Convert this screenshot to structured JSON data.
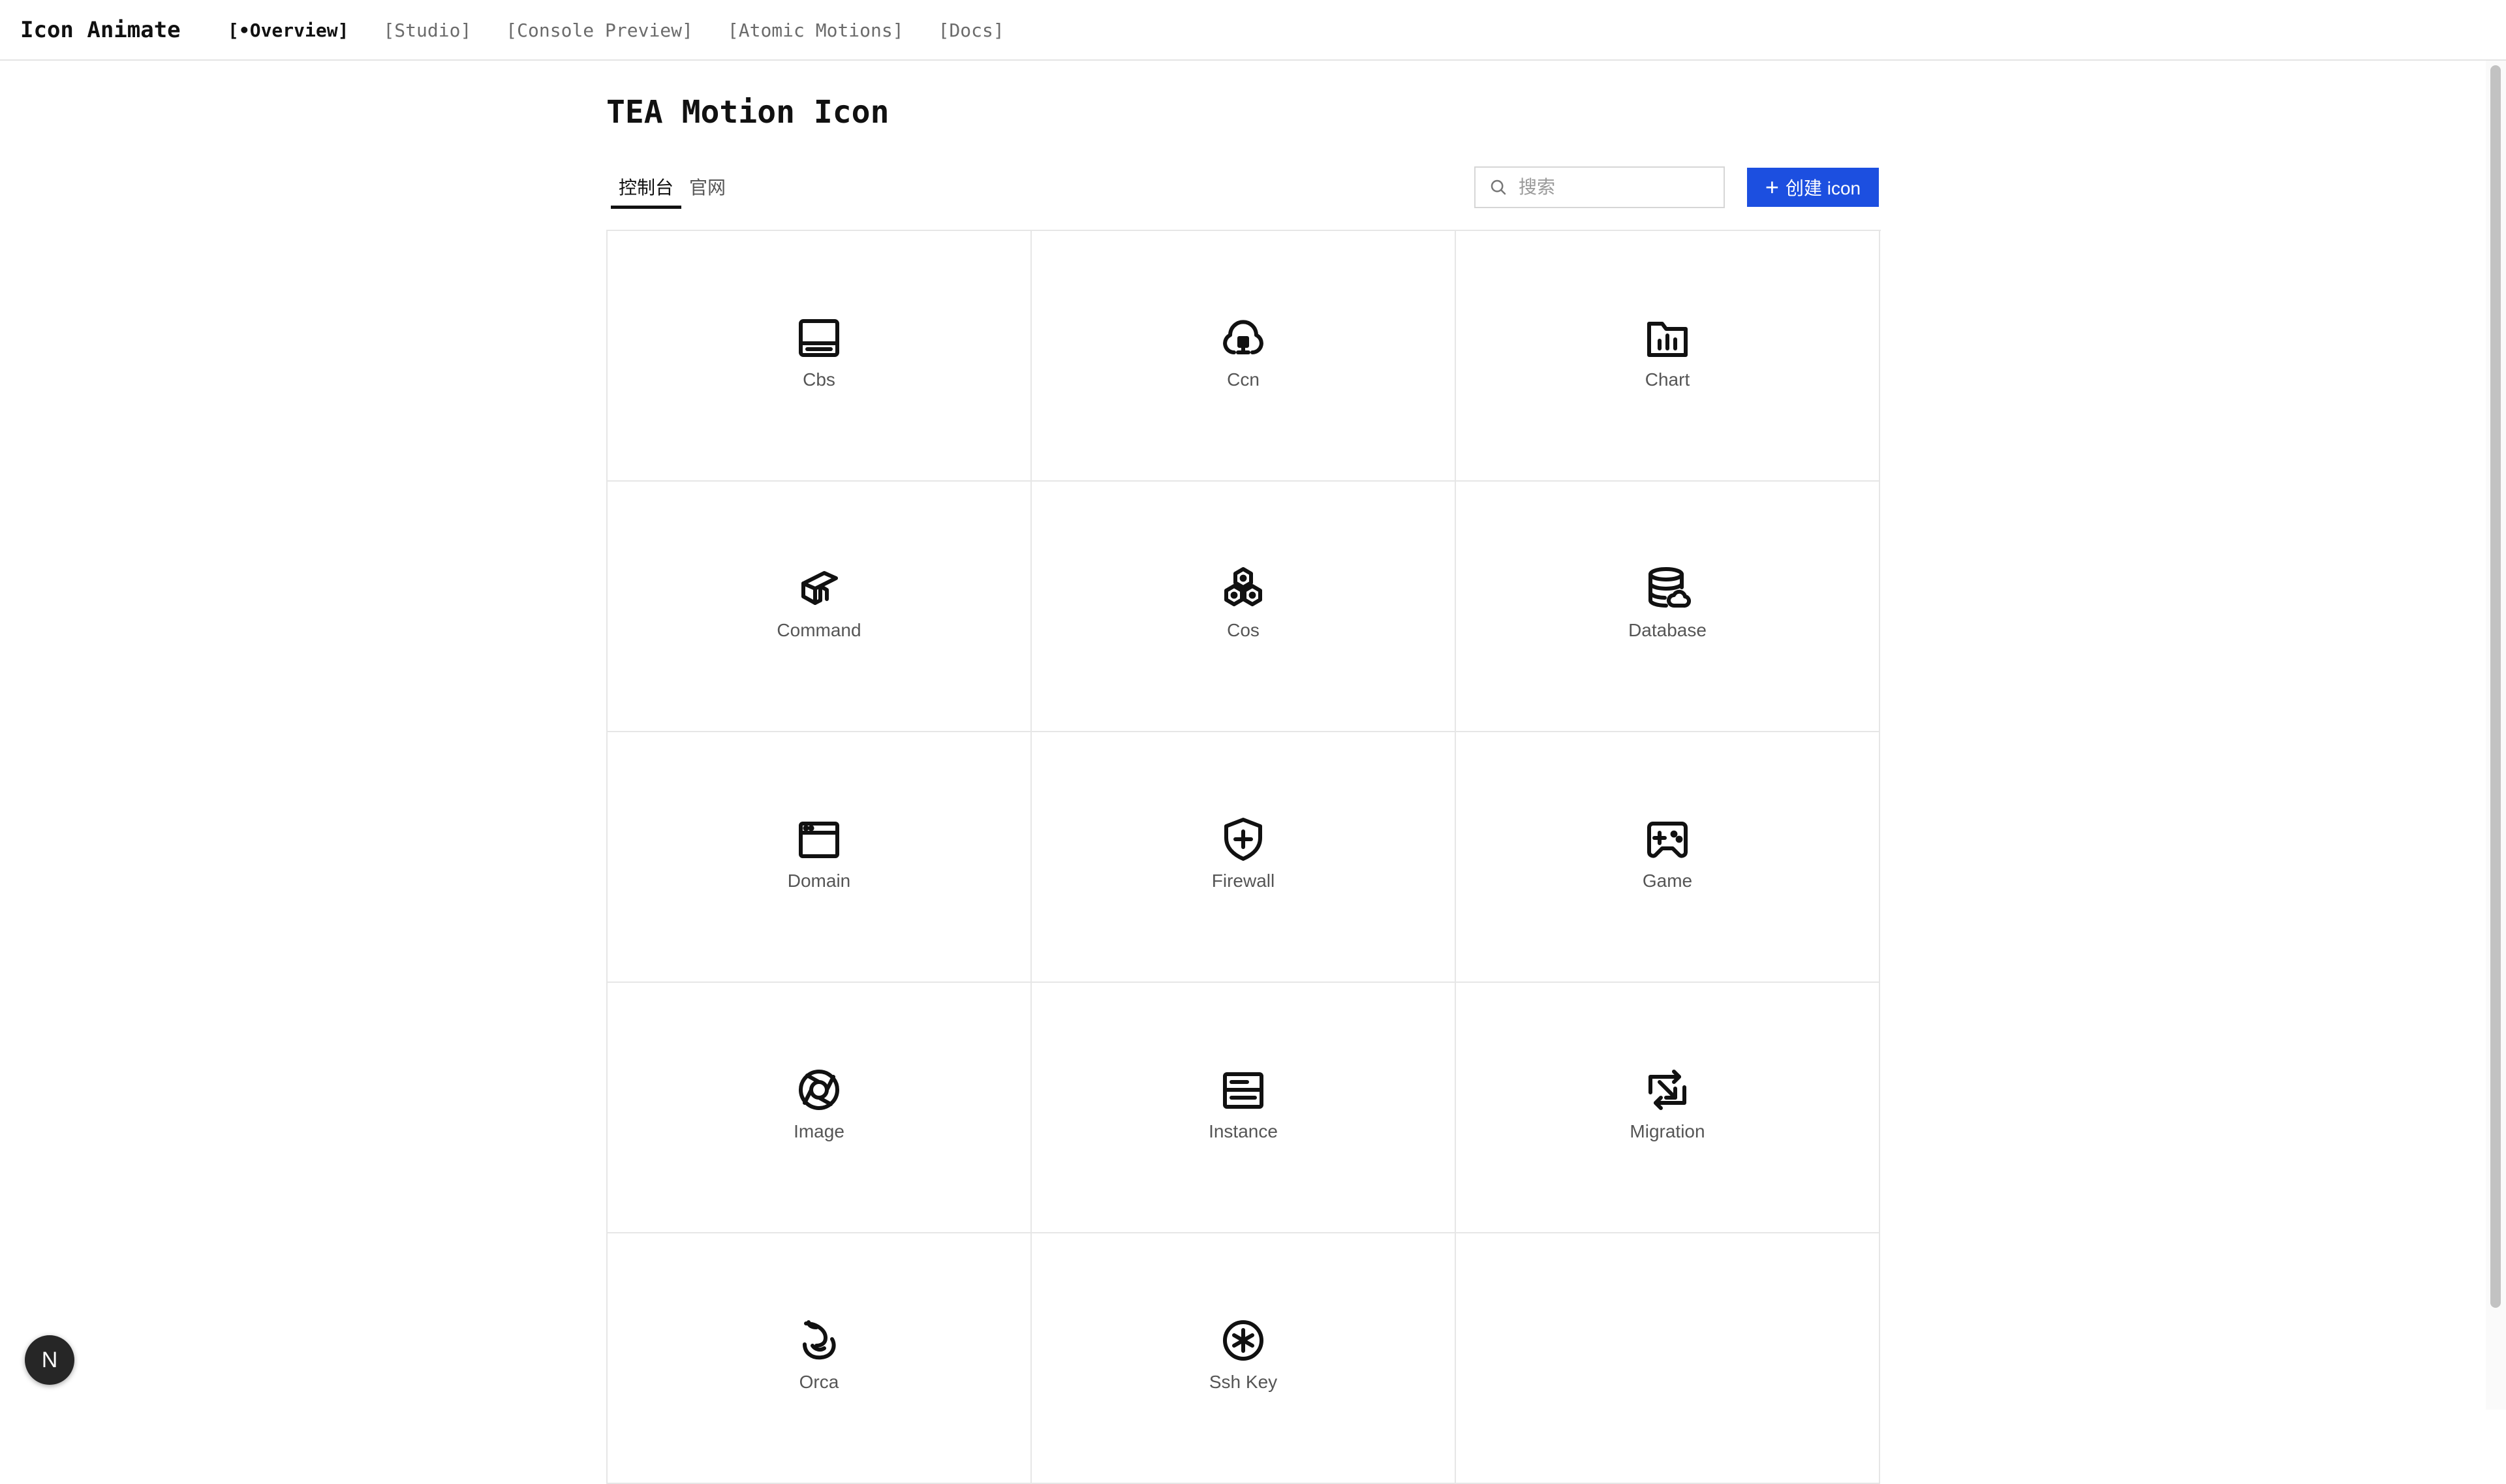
{
  "app": {
    "brand": "Icon Animate",
    "nav": [
      {
        "label": "[•Overview]",
        "active": true
      },
      {
        "label": "[Studio]",
        "active": false
      },
      {
        "label": "[Console Preview]",
        "active": false
      },
      {
        "label": "[Atomic Motions]",
        "active": false
      },
      {
        "label": "[Docs]",
        "active": false
      }
    ]
  },
  "main": {
    "title": "TEA Motion Icon",
    "tabs": [
      {
        "label": "控制台",
        "active": true
      },
      {
        "label": "官网",
        "active": false
      }
    ],
    "search": {
      "placeholder": "搜索",
      "value": ""
    },
    "create_button": {
      "label": "创建 icon",
      "icon": "plus-icon"
    },
    "icons": [
      {
        "label": "Cbs",
        "icon": "cbs-icon"
      },
      {
        "label": "Ccn",
        "icon": "ccn-icon"
      },
      {
        "label": "Chart",
        "icon": "chart-icon"
      },
      {
        "label": "Command",
        "icon": "command-icon"
      },
      {
        "label": "Cos",
        "icon": "cos-icon"
      },
      {
        "label": "Database",
        "icon": "database-icon"
      },
      {
        "label": "Domain",
        "icon": "domain-icon"
      },
      {
        "label": "Firewall",
        "icon": "firewall-icon"
      },
      {
        "label": "Game",
        "icon": "game-icon"
      },
      {
        "label": "Image",
        "icon": "image-icon"
      },
      {
        "label": "Instance",
        "icon": "instance-icon"
      },
      {
        "label": "Migration",
        "icon": "migration-icon"
      },
      {
        "label": "Orca",
        "icon": "orca-icon"
      },
      {
        "label": "Ssh Key",
        "icon": "ssh-key-icon"
      }
    ]
  },
  "devtools_badge": {
    "label": "N"
  },
  "colors": {
    "accent": "#1c4fe0",
    "text": "#111111",
    "muted": "#555555",
    "border": "#e6e6e6"
  }
}
